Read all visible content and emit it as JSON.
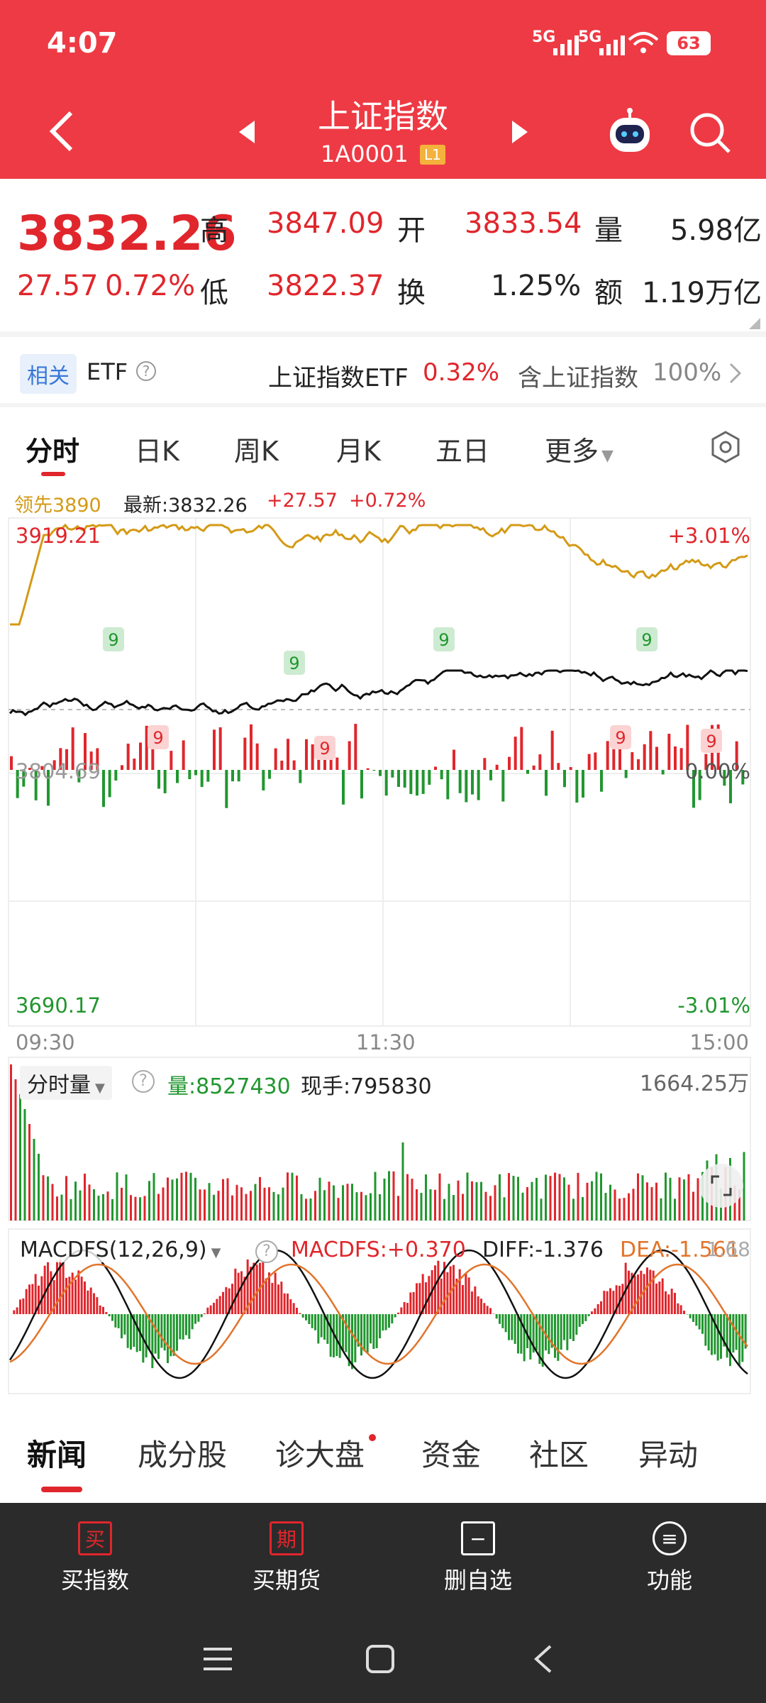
{
  "status": {
    "time": "4:07",
    "net1": "5G",
    "net2": "5G",
    "battery": "63"
  },
  "header": {
    "title": "上证指数",
    "code": "1A0001",
    "level": "L1"
  },
  "quote": {
    "price": "3832.26",
    "change": "27.57",
    "pct": "0.72%",
    "high_label": "高",
    "high": "3847.09",
    "open_label": "开",
    "open": "3833.54",
    "vol_label": "量",
    "vol": "5.98亿",
    "low_label": "低",
    "low": "3822.37",
    "turn_label": "换",
    "turn": "1.25%",
    "amt_label": "额",
    "amt": "1.19万亿"
  },
  "etf": {
    "badge": "相关",
    "label": "ETF",
    "name": "上证指数ETF",
    "pct": "0.32%",
    "contain": "含上证指数",
    "contain_pct": "100%"
  },
  "tabs": [
    "分时",
    "日K",
    "周K",
    "月K",
    "五日",
    "更多"
  ],
  "chart": {
    "legend": {
      "lead": "领先3890",
      "latest": "最新:3832.26",
      "chg": "+27.57",
      "pct": "+0.72%"
    },
    "top_left": "3919.21",
    "top_right": "+3.01%",
    "mid_left": "3804.69",
    "mid_right": "0.00%",
    "bot_left": "3690.17",
    "bot_right": "-3.01%",
    "t_start": "09:30",
    "t_mid": "11:30",
    "t_end": "15:00",
    "nine": "9"
  },
  "volume": {
    "label": "分时量",
    "qty_label": "量:8527430",
    "hand_label": "现手:795830",
    "max": "1664.25万"
  },
  "macd": {
    "label": "MACDFS(12,26,9)",
    "macdfs": "MACDFS:+0.370",
    "diff": "DIFF:-1.376",
    "dea": "DEA:-1.561",
    "right": "1.68"
  },
  "btabs": [
    "新闻",
    "成分股",
    "诊大盘",
    "资金",
    "社区",
    "异动"
  ],
  "bottom": [
    {
      "icon": "买",
      "label": "买指数"
    },
    {
      "icon": "期",
      "label": "买期货"
    },
    {
      "icon": "−",
      "label": "删自选"
    },
    {
      "icon": "≡",
      "label": "功能"
    }
  ],
  "colors": {
    "header": "#ee3a44",
    "up": "#e0262c",
    "down": "#21962f",
    "lead": "#d49a15"
  }
}
